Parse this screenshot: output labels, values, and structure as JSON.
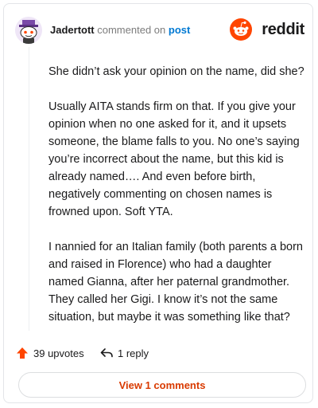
{
  "header": {
    "author": "Jadertott",
    "action": "commented on",
    "link": "post",
    "brand": "reddit",
    "avatar_icon": "snoo-avatar-icon",
    "brand_icon": "reddit-logo-icon"
  },
  "comment": {
    "paragraphs": [
      "She didn’t ask your opinion on the name, did she?",
      "Usually AITA stands firm on that. If you give your opinion when no one asked for it, and it upsets someone, the blame falls to you. No one’s saying you’re incorrect about the name, but this kid is already named…. And even before birth, negatively commenting on chosen names is frowned upon. Soft YTA.",
      "I nannied for an Italian family (both parents a born and raised in Florence) who had a daughter named Gianna, after her paternal grandmother. They called her Gigi. I know it’s not the same situation, but maybe it was something like that?"
    ]
  },
  "actions": {
    "upvotes": "39 upvotes",
    "replies": "1 reply",
    "upvote_icon": "upvote-arrow-icon",
    "reply_icon": "reply-arrow-icon"
  },
  "footer": {
    "view_comments": "View 1 comments"
  },
  "colors": {
    "brand_orange": "#ff4500",
    "link_blue": "#0079d3",
    "button_text": "#d93a00"
  }
}
